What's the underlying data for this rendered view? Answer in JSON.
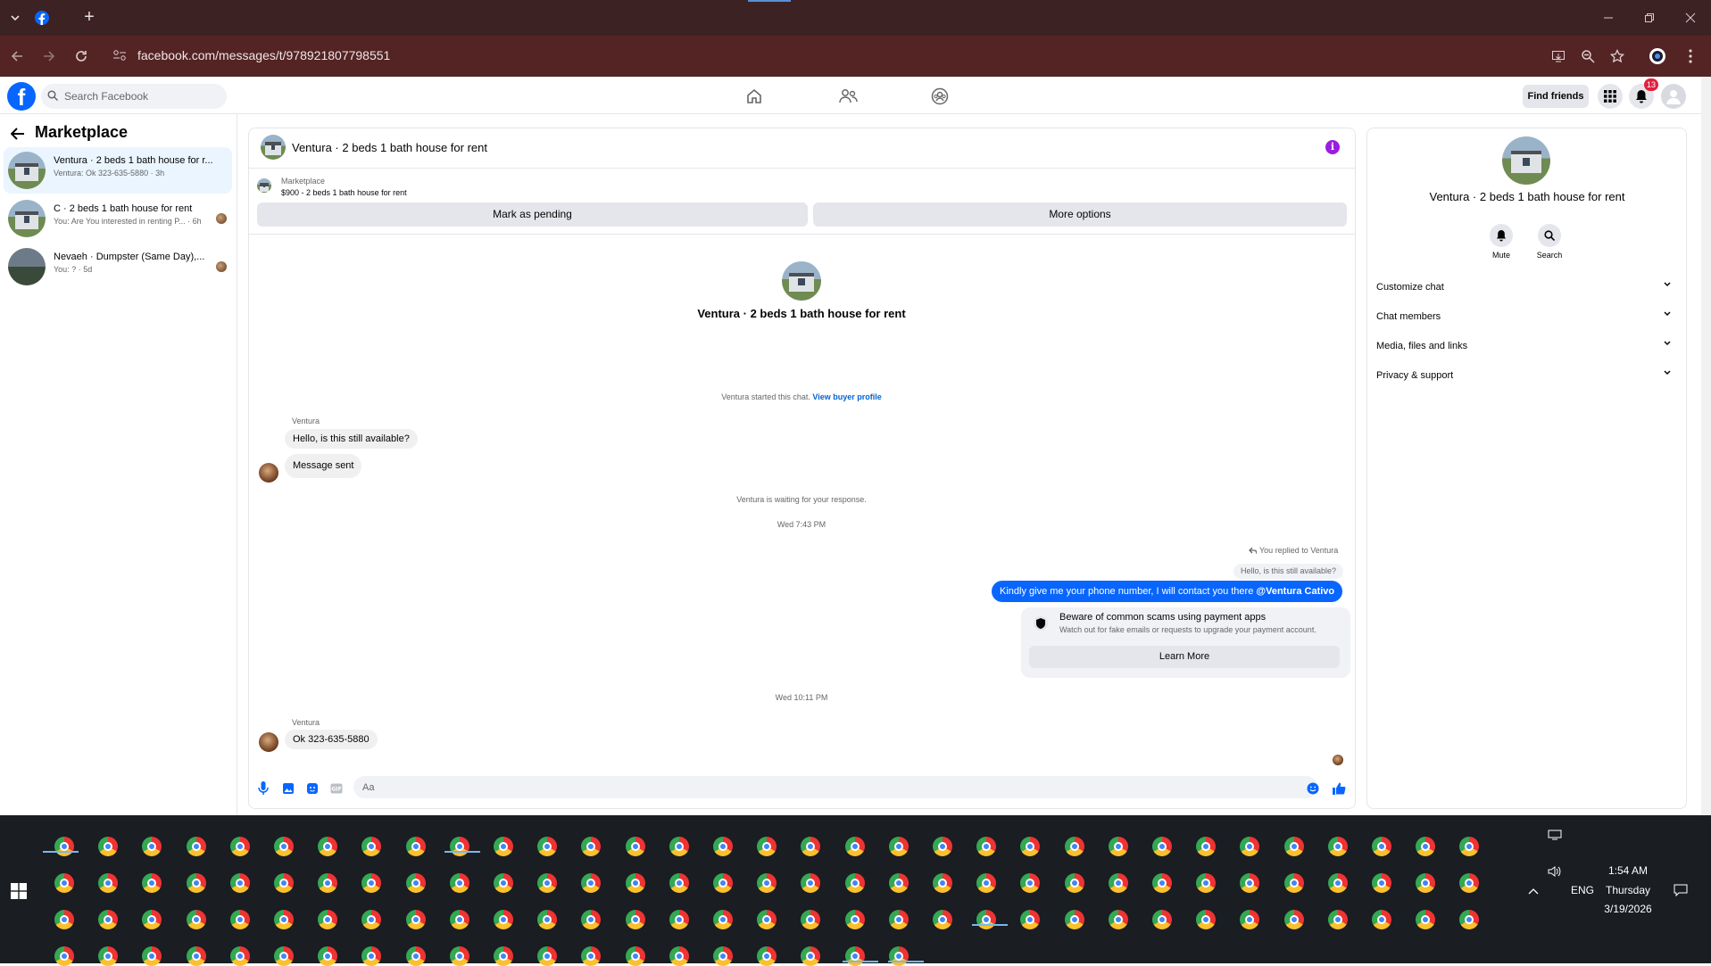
{
  "browser": {
    "url": "facebook.com/messages/t/978921807798551"
  },
  "facebook": {
    "search_placeholder": "Search Facebook",
    "find_friends": "Find friends",
    "notification_count": "13"
  },
  "left_panel": {
    "title": "Marketplace",
    "conversations": [
      {
        "title": "Ventura · 2 beds 1 bath house for r...",
        "subtitle": "Ventura: Ok 323-635-5880 · 3h"
      },
      {
        "title": "C · 2 beds 1 bath house for rent",
        "subtitle": "You: Are You interested in renting P... · 6h"
      },
      {
        "title": "Nevaeh · Dumpster (Same Day),...",
        "subtitle": "You: ? · 5d"
      }
    ]
  },
  "chat": {
    "header_title": "Ventura · 2 beds 1 bath house for rent",
    "listing_label": "Marketplace",
    "listing_price": "$900 - 2 beds 1 bath house for rent",
    "mark_pending": "Mark as pending",
    "more_options": "More options",
    "hero_title": "Ventura · 2 beds 1 bath house for rent",
    "started_text": "Ventura started this chat.",
    "view_buyer_profile": "View buyer profile",
    "sender_name_1": "Ventura",
    "msg_1": "Hello, is this still available?",
    "msg_2": "Message sent",
    "waiting_text": "Ventura is waiting for your response.",
    "time_1": "Wed 7:43 PM",
    "reply_note": "You replied to Ventura",
    "reply_quote": "Hello, is this still available?",
    "my_msg_text": "Kindly give me your phone number, I will contact you there ",
    "my_msg_mention": "@Ventura Cativo",
    "scam_title": "Beware of common scams using payment apps",
    "scam_sub": "Watch out for fake emails or requests to upgrade your payment account.",
    "learn_more": "Learn More",
    "time_2": "Wed 10:11 PM",
    "sender_name_2": "Ventura",
    "msg_3": "Ok 323-635-5880",
    "composer_placeholder": "Aa"
  },
  "right_panel": {
    "title": "Ventura · 2 beds 1 bath house for rent",
    "mute": "Mute",
    "search": "Search",
    "rows": [
      "Customize chat",
      "Chat members",
      "Media, files and links",
      "Privacy & support"
    ]
  },
  "taskbar": {
    "time": "1:54 AM",
    "day": "Thursday",
    "date": "3/19/2026",
    "lang": "ENG"
  },
  "colors": {
    "brand": "#0866ff",
    "tab_bar": "#3c2222",
    "address_bar": "#542424",
    "taskbar": "#1a1d22"
  }
}
